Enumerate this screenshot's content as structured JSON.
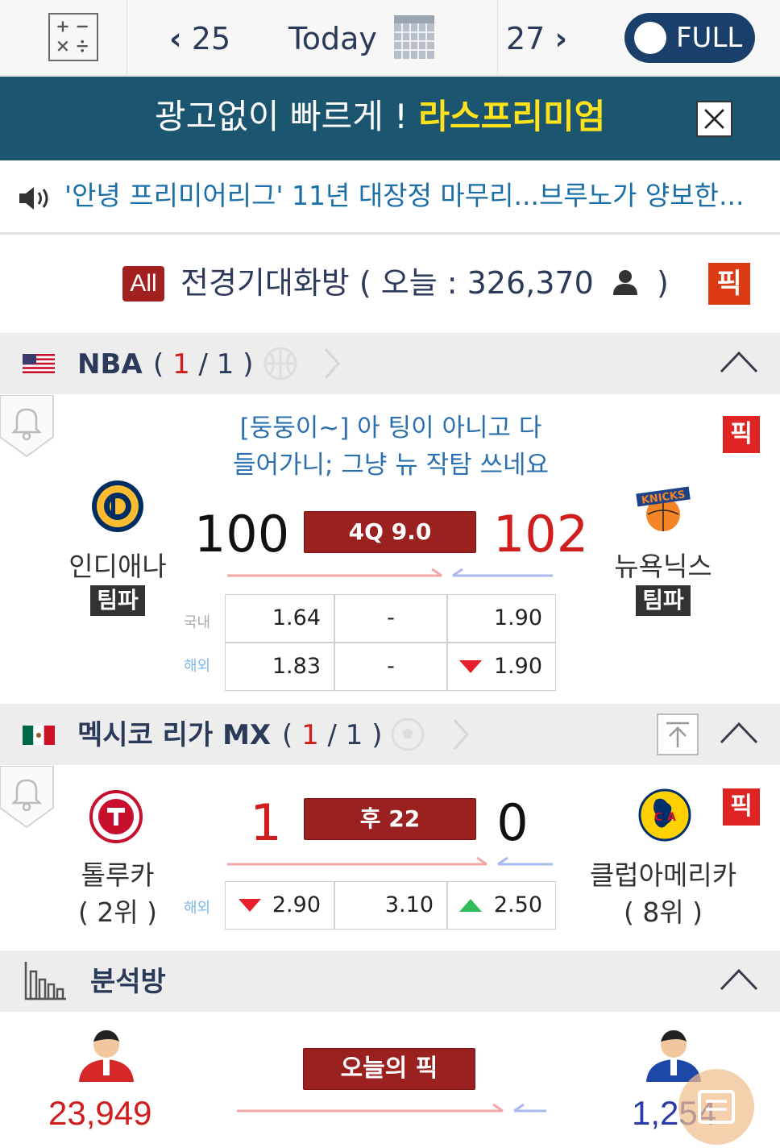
{
  "nav": {
    "prev_date": "25",
    "today": "Today",
    "next_date": "27",
    "full_toggle": "FULL"
  },
  "banner": {
    "text": "광고없이 빠르게 !",
    "highlight": "라스프리미엄"
  },
  "news": {
    "headline": "'안녕 프리미어리그' 11년 대장정 마무리...브루노가 양보한..."
  },
  "chat": {
    "badge": "All",
    "title": "전경기대화방 ( 오늘 : 326,370",
    "title_end": ")",
    "pick": "픽"
  },
  "leagues": [
    {
      "name": "NBA",
      "count_open": "(",
      "count_current": "1",
      "count_total": "/ 1 )",
      "match": {
        "comment_line1": "[둥둥이~] 아 팅이 아니고 다",
        "comment_line2": "들어가니; 그냥 뉴 작탐 쓰네요",
        "home_team": "인디애나",
        "home_tag": "팀파",
        "away_team": "뉴욕닉스",
        "away_tag": "팀파",
        "home_score": "100",
        "away_score": "102",
        "status": "4Q  9.0",
        "pick": "픽",
        "odds_rows": [
          {
            "label": "국내",
            "home": "1.64",
            "draw": "-",
            "away": "1.90"
          },
          {
            "label": "해외",
            "home": "1.83",
            "draw": "-",
            "away": "1.90"
          }
        ]
      }
    },
    {
      "name": "멕시코 리가 MX",
      "count_open": "(",
      "count_current": "1",
      "count_total": "/ 1 )",
      "match": {
        "home_team": "톨루카",
        "home_rank": "( 2위 )",
        "away_team": "클럽아메리카",
        "away_rank": "( 8위 )",
        "home_score": "1",
        "away_score": "0",
        "status": "후 22",
        "pick": "픽",
        "odds_rows": [
          {
            "label": "해외",
            "home": "2.90",
            "draw": "3.10",
            "away": "2.50"
          }
        ]
      }
    }
  ],
  "analysis": {
    "title": "분석방",
    "today_pick": "오늘의 픽",
    "left_count": "23,949",
    "right_count": "1,254"
  },
  "colors": {
    "banner_bg": "#1b5570",
    "banner_highlight": "#ffe21a",
    "status_box": "#9b2121",
    "score_red": "#d01d1d",
    "news_blue": "#1b6fa8",
    "pick_red": "#e02323"
  }
}
